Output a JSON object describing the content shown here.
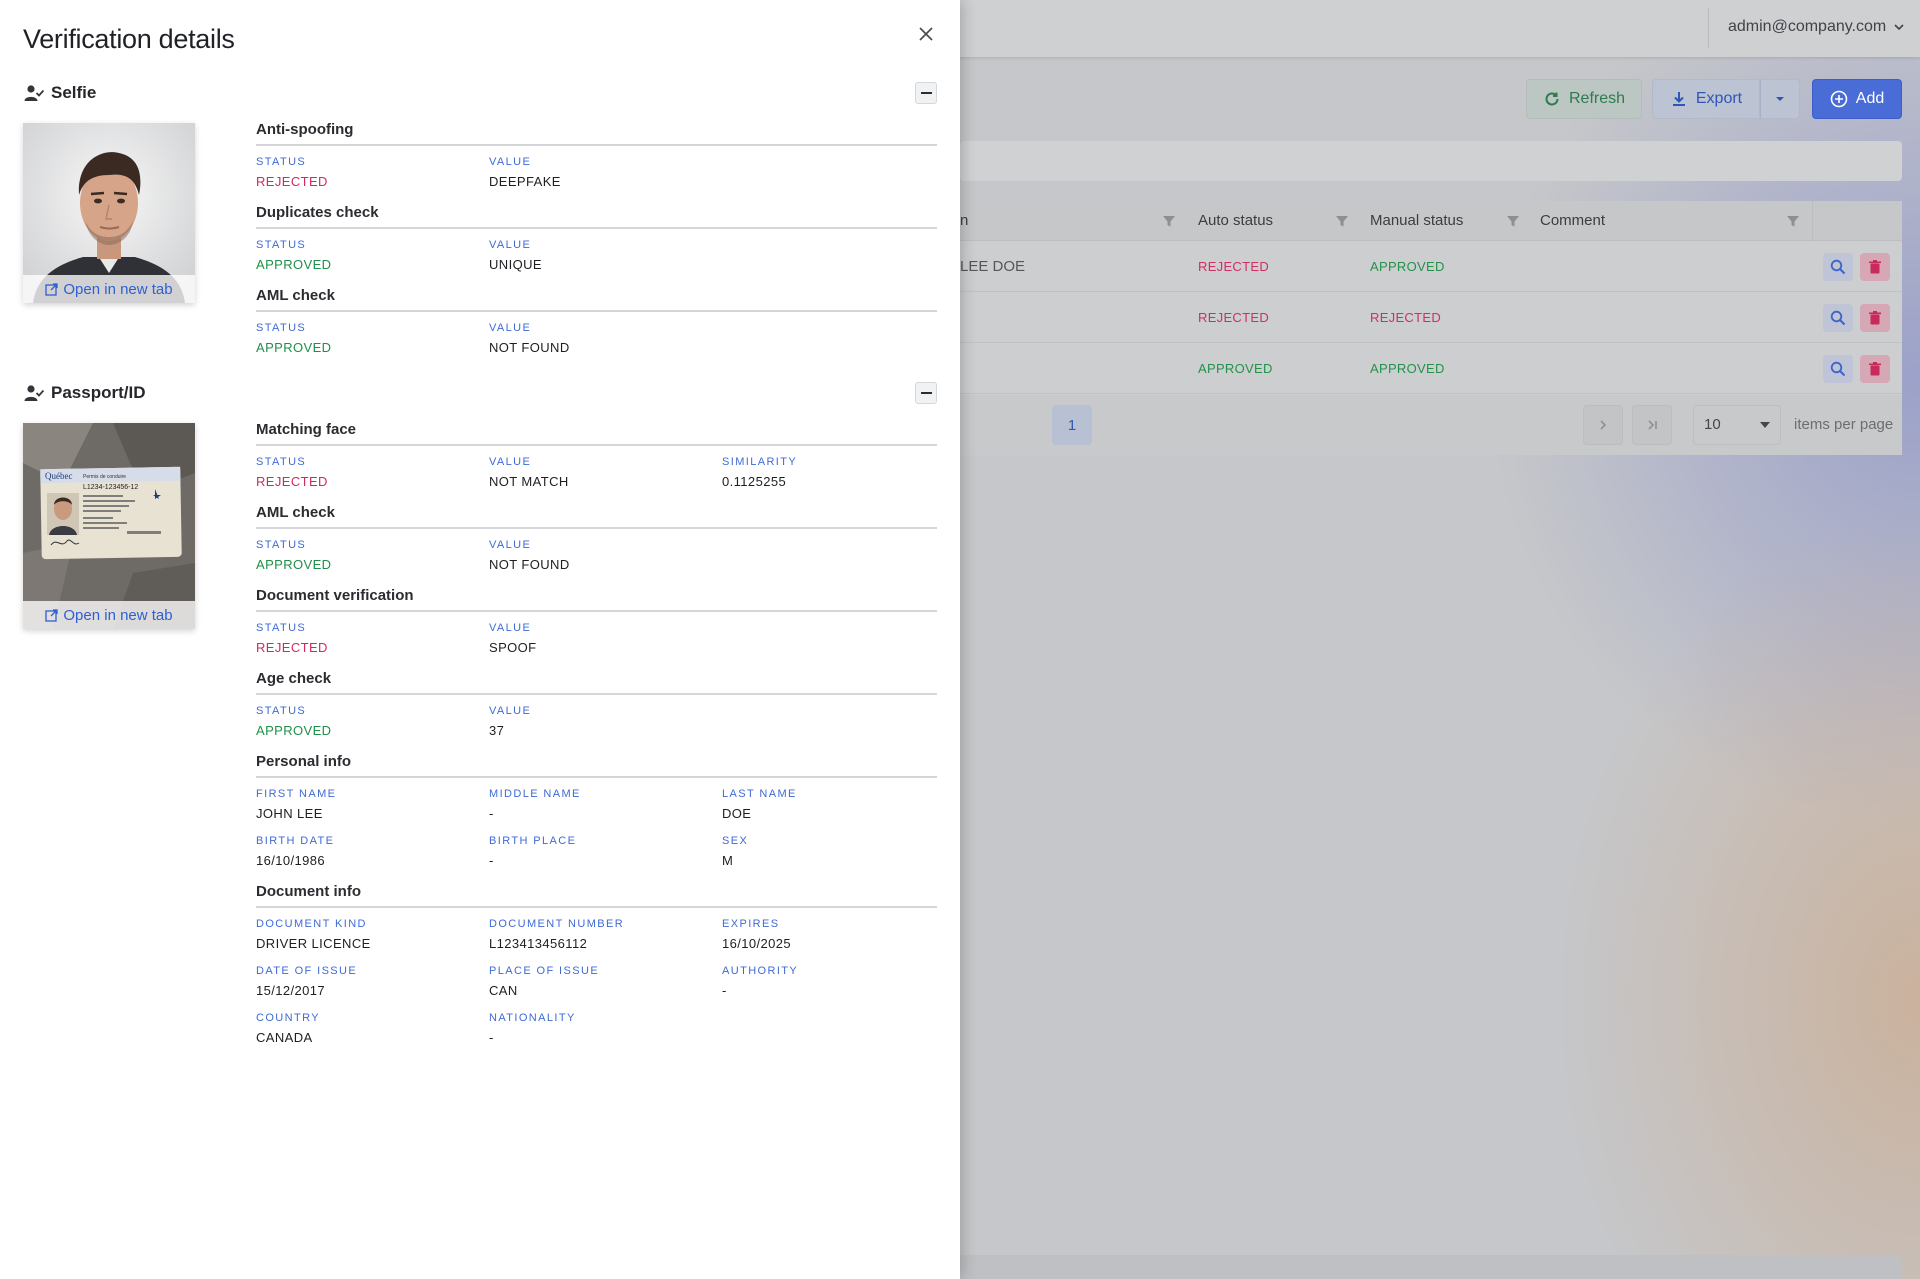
{
  "drawer": {
    "title": "Verification details",
    "open_link": "Open in new tab",
    "selfie": {
      "title": "Selfie",
      "groups": [
        {
          "title": "Anti-spoofing",
          "fields": [
            {
              "label": "Status",
              "value": "REJECTED",
              "tone": "rej"
            },
            {
              "label": "Value",
              "value": "DEEPFAKE",
              "tone": ""
            }
          ]
        },
        {
          "title": "Duplicates check",
          "fields": [
            {
              "label": "Status",
              "value": "APPROVED",
              "tone": "app"
            },
            {
              "label": "Value",
              "value": "UNIQUE",
              "tone": ""
            }
          ]
        },
        {
          "title": "AML check",
          "fields": [
            {
              "label": "Status",
              "value": "APPROVED",
              "tone": "app"
            },
            {
              "label": "Value",
              "value": "NOT FOUND",
              "tone": ""
            }
          ]
        }
      ]
    },
    "passport": {
      "title": "Passport/ID",
      "card_text": {
        "province": "Québec",
        "permit": "Permis de conduire",
        "number": "L1234-123456-12"
      },
      "groups": [
        {
          "title": "Matching face",
          "fields": [
            {
              "label": "Status",
              "value": "REJECTED",
              "tone": "rej"
            },
            {
              "label": "Value",
              "value": "NOT MATCH",
              "tone": ""
            },
            {
              "label": "Similarity",
              "value": "0.1125255",
              "tone": ""
            }
          ]
        },
        {
          "title": "AML check",
          "fields": [
            {
              "label": "Status",
              "value": "APPROVED",
              "tone": "app"
            },
            {
              "label": "Value",
              "value": "NOT FOUND",
              "tone": ""
            }
          ]
        },
        {
          "title": "Document verification",
          "fields": [
            {
              "label": "Status",
              "value": "REJECTED",
              "tone": "rej"
            },
            {
              "label": "Value",
              "value": "SPOOF",
              "tone": ""
            }
          ]
        },
        {
          "title": "Age check",
          "fields": [
            {
              "label": "Status",
              "value": "APPROVED",
              "tone": "app"
            },
            {
              "label": "Value",
              "value": "37",
              "tone": ""
            }
          ]
        },
        {
          "title": "Personal info",
          "fields": [
            {
              "label": "First name",
              "value": "JOHN LEE",
              "tone": ""
            },
            {
              "label": "Middle name",
              "value": "-",
              "tone": ""
            },
            {
              "label": "Last name",
              "value": "DOE",
              "tone": ""
            },
            {
              "label": "Birth date",
              "value": "16/10/1986",
              "tone": ""
            },
            {
              "label": "Birth place",
              "value": "-",
              "tone": ""
            },
            {
              "label": "Sex",
              "value": "M",
              "tone": ""
            }
          ]
        },
        {
          "title": "Document info",
          "fields": [
            {
              "label": "Document kind",
              "value": "DRIVER LICENCE",
              "tone": ""
            },
            {
              "label": "Document number",
              "value": "L123413456112",
              "tone": ""
            },
            {
              "label": "Expires",
              "value": "16/10/2025",
              "tone": ""
            },
            {
              "label": "Date of issue",
              "value": "15/12/2017",
              "tone": ""
            },
            {
              "label": "Place of issue",
              "value": "CAN",
              "tone": ""
            },
            {
              "label": "Authority",
              "value": "-",
              "tone": ""
            },
            {
              "label": "Country",
              "value": "CANADA",
              "tone": ""
            },
            {
              "label": "Nationality",
              "value": "-",
              "tone": ""
            }
          ]
        }
      ]
    }
  },
  "topbar": {
    "user": "admin@company.com"
  },
  "toolbar": {
    "refresh": "Refresh",
    "export": "Export",
    "add": "Add"
  },
  "table": {
    "columns": [
      "n",
      "Auto status",
      "Manual status",
      "Comment"
    ],
    "rows": [
      {
        "name": "LEE DOE",
        "auto": "REJECTED",
        "auto_tone": "rej",
        "manual": "APPROVED",
        "manual_tone": "app"
      },
      {
        "name": "",
        "auto": "REJECTED",
        "auto_tone": "rej",
        "manual": "REJECTED",
        "manual_tone": "rej"
      },
      {
        "name": "",
        "auto": "APPROVED",
        "auto_tone": "app",
        "manual": "APPROVED",
        "manual_tone": "app"
      }
    ],
    "pager": {
      "current_page": "1",
      "page_size": "10",
      "items_per_page": "items per page"
    }
  },
  "colors": {
    "accent": "#3e6ad6",
    "rejected": "#d02a5e",
    "approved": "#1f9048",
    "primary_button": "#4a6cd6"
  },
  "icons": {
    "close": "close-icon",
    "section": "user-check-icon",
    "collapse": "minus-icon",
    "external": "external-link-icon",
    "refresh": "refresh-icon",
    "export": "download-icon",
    "add": "plus-circle-icon",
    "filter": "filter-icon",
    "view": "search-icon",
    "delete": "trash-icon"
  }
}
